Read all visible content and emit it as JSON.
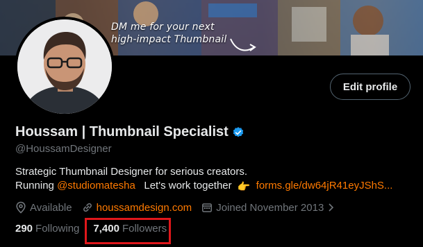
{
  "banner": {
    "caption_line1": "DM me for your next",
    "caption_line2": "high-impact Thumbnail"
  },
  "header": {
    "edit_profile_label": "Edit profile"
  },
  "profile": {
    "display_name": "Houssam | Thumbnail Specialist",
    "verified_icon": "verified-badge-icon",
    "verified_color": "#1d9bf0",
    "handle": "@HoussamDesigner",
    "bio_line1": "Strategic Thumbnail Designer for serious creators.",
    "bio_line2_prefix": "Running",
    "bio_mention": "@studiomatesha",
    "bio_line2_middle": "Let's work together",
    "bio_emoji": "👉",
    "bio_link": "forms.gle/dw64jR41eyJShS...",
    "link_color": "#ff7a00"
  },
  "meta": {
    "location": "Available",
    "website": "houssamdesign.com",
    "joined": "Joined November 2013"
  },
  "stats": {
    "following_count": "290",
    "following_label": "Following",
    "followers_count": "7,400",
    "followers_label": "Followers",
    "highlight_color": "#e0171b"
  }
}
